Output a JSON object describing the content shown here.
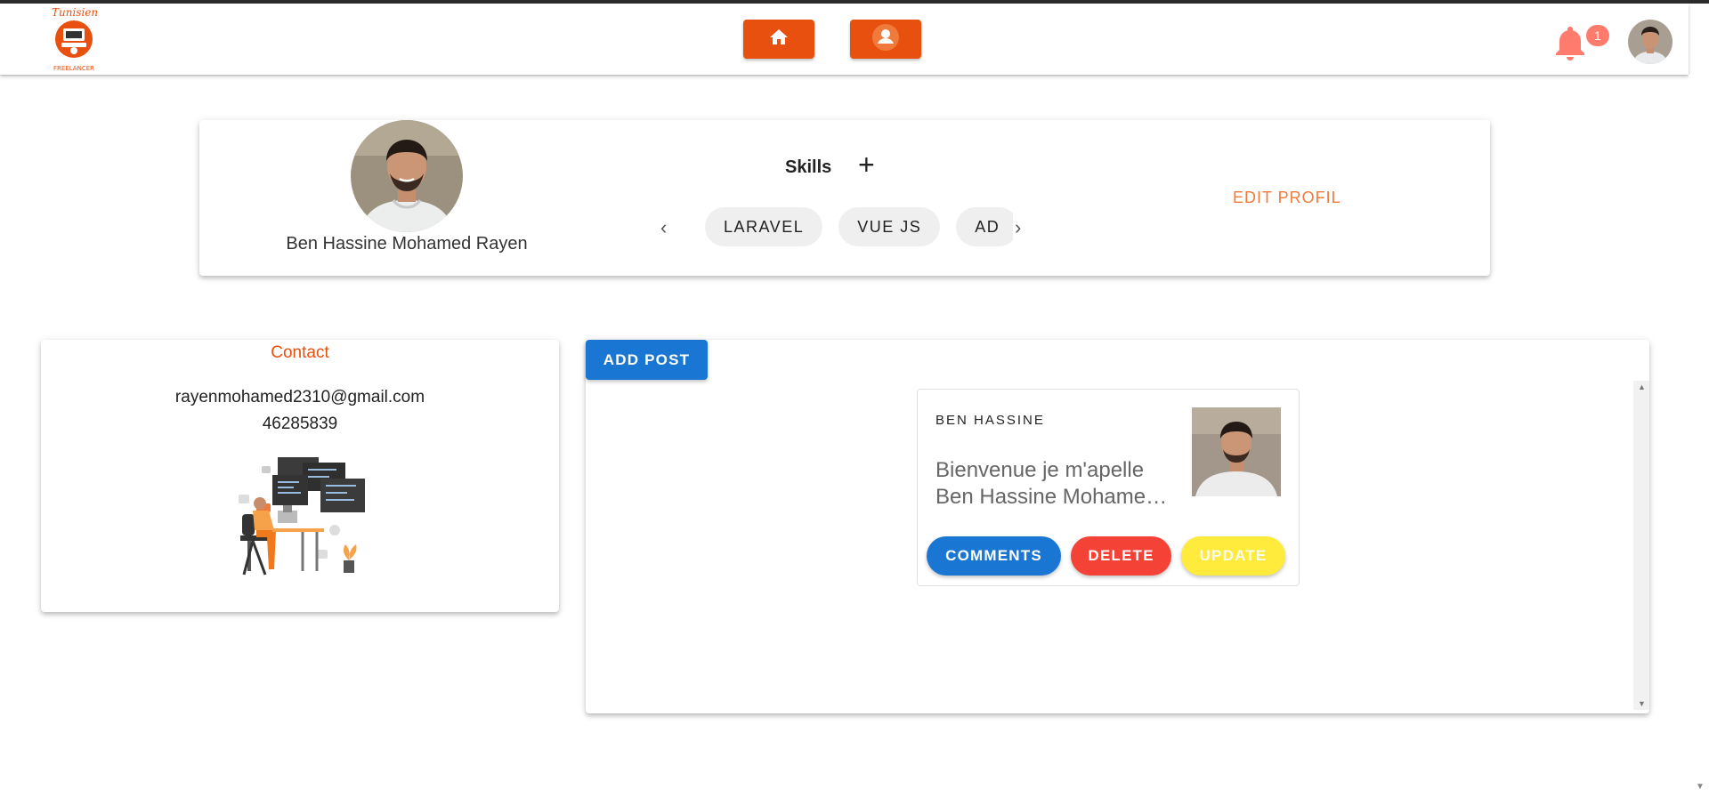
{
  "brand": {
    "logo_text_top": "Tunisien",
    "logo_text_bottom": "FREELANCER",
    "accent": "#e8500f"
  },
  "nav": {
    "home_icon": "home-icon",
    "profile_icon": "person-icon"
  },
  "notifications": {
    "count": "1",
    "icon": "bell-icon"
  },
  "profile": {
    "name": "Ben Hassine Mohamed Rayen",
    "skills_title": "Skills",
    "add_skill": "+",
    "skills": [
      "LARAVEL",
      "VUE JS",
      "AD"
    ],
    "edit_label": "EDIT PROFIL"
  },
  "contact": {
    "title": "Contact",
    "email": "rayenmohamed2310@gmail.com",
    "phone": "46285839"
  },
  "posts": {
    "add_label": "ADD POST",
    "items": [
      {
        "author": "BEN HASSINE",
        "text_line1": "Bienvenue je m'apelle",
        "text_line2": "Ben Hassine Mohamed Rayen",
        "comments_label": "COMMENTS",
        "delete_label": "DELETE",
        "update_label": "UPDATE"
      }
    ]
  }
}
